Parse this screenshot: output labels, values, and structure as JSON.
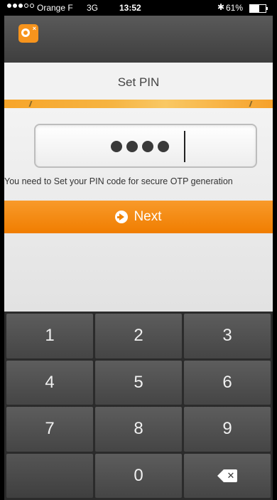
{
  "status_bar": {
    "carrier": "Orange F",
    "network": "3G",
    "time": "13:52",
    "battery": "61%",
    "battery_level": 0.61
  },
  "app_header": {
    "logo_icon": "orange-app-logo-icon"
  },
  "page": {
    "title": "Set PIN"
  },
  "pin_input": {
    "masked_value": "••••",
    "digits_entered": 4
  },
  "hint_text": "You need to Set your PIN code for secure OTP generation",
  "next_button": {
    "label": "Next",
    "icon": "arrow-right-circle-icon"
  },
  "keypad": {
    "keys": [
      "1",
      "2",
      "3",
      "4",
      "5",
      "6",
      "7",
      "8",
      "9",
      "",
      "0"
    ],
    "backspace_icon": "backspace-icon"
  },
  "colors": {
    "accent": "#f07d00",
    "header": "#4a4a4a",
    "keypad": "#4e4e4e"
  }
}
